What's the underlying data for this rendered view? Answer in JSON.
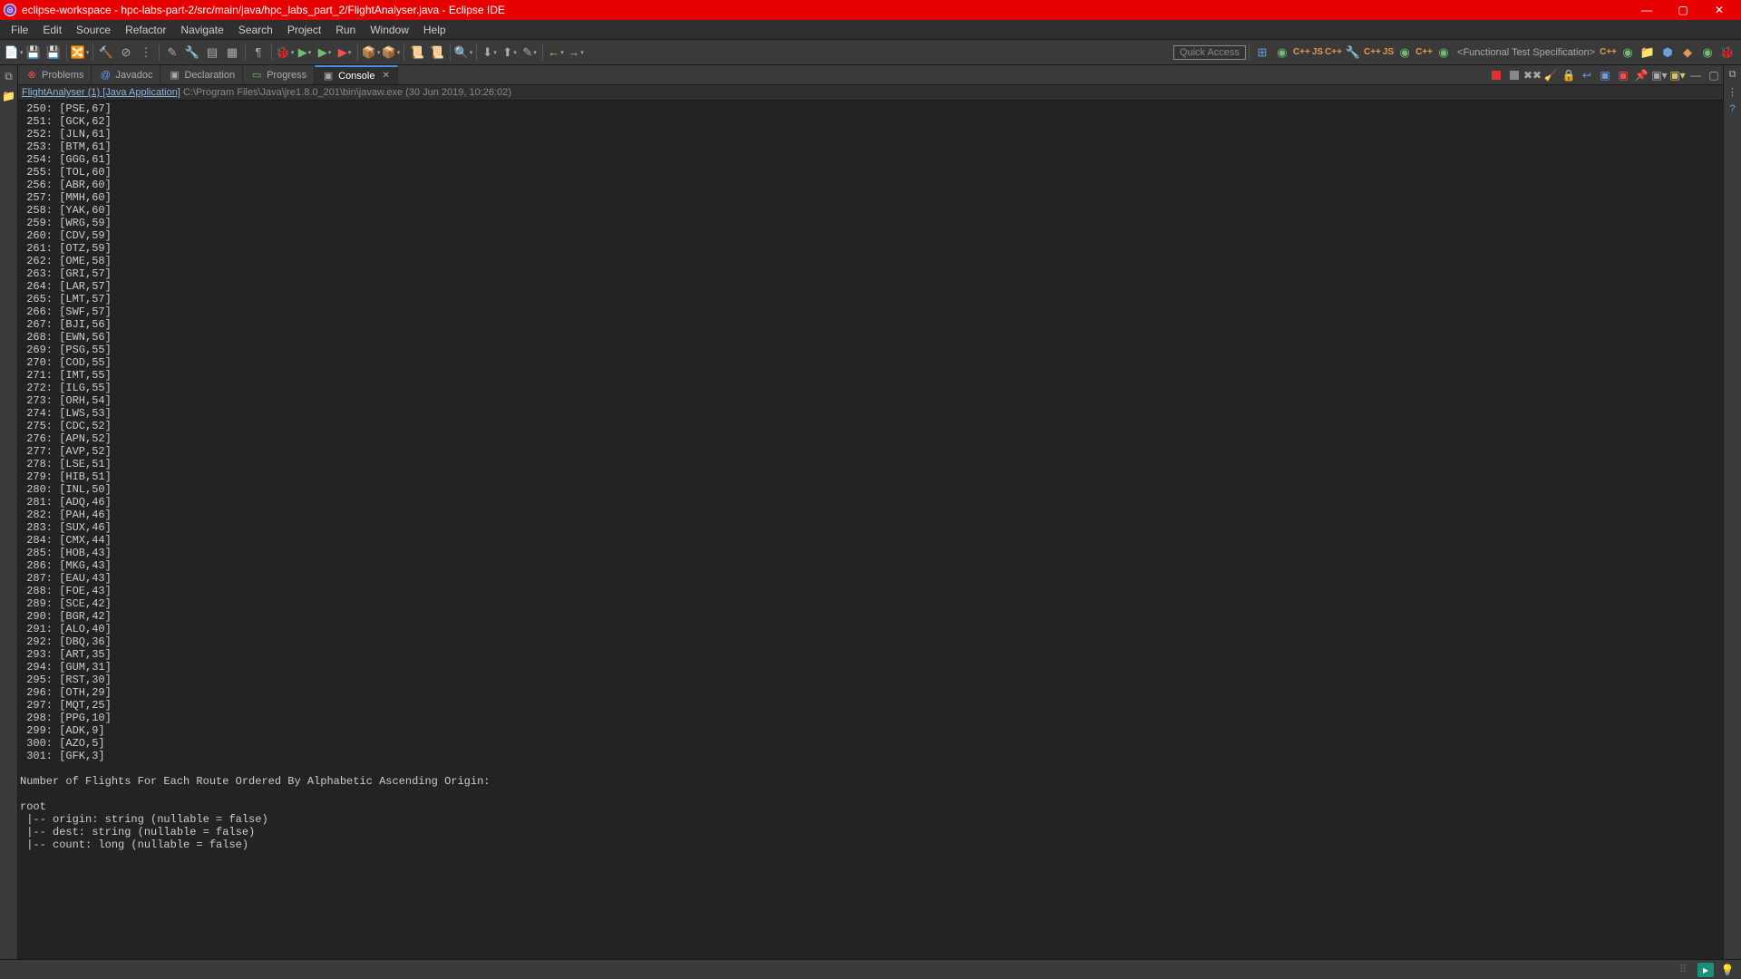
{
  "window": {
    "title": "eclipse-workspace - hpc-labs-part-2/src/main/java/hpc_labs_part_2/FlightAnalyser.java - Eclipse IDE"
  },
  "menu": [
    "File",
    "Edit",
    "Source",
    "Refactor",
    "Navigate",
    "Search",
    "Project",
    "Run",
    "Window",
    "Help"
  ],
  "quick_access": "Quick Access",
  "perspective_label": "<Functional Test Specification>",
  "tabs": {
    "problems": "Problems",
    "javadoc": "Javadoc",
    "declaration": "Declaration",
    "progress": "Progress",
    "console": "Console"
  },
  "launch": {
    "name": "FlightAnalyser (1) [Java Application]",
    "path": "C:\\Program Files\\Java\\jre1.8.0_201\\bin\\javaw.exe (30 Jun 2019, 10:26:02)"
  },
  "console_lines": [
    " 250: [PSE,67]",
    " 251: [GCK,62]",
    " 252: [JLN,61]",
    " 253: [BTM,61]",
    " 254: [GGG,61]",
    " 255: [TOL,60]",
    " 256: [ABR,60]",
    " 257: [MMH,60]",
    " 258: [YAK,60]",
    " 259: [WRG,59]",
    " 260: [CDV,59]",
    " 261: [OTZ,59]",
    " 262: [OME,58]",
    " 263: [GRI,57]",
    " 264: [LAR,57]",
    " 265: [LMT,57]",
    " 266: [SWF,57]",
    " 267: [BJI,56]",
    " 268: [EWN,56]",
    " 269: [PSG,55]",
    " 270: [COD,55]",
    " 271: [IMT,55]",
    " 272: [ILG,55]",
    " 273: [ORH,54]",
    " 274: [LWS,53]",
    " 275: [CDC,52]",
    " 276: [APN,52]",
    " 277: [AVP,52]",
    " 278: [LSE,51]",
    " 279: [HIB,51]",
    " 280: [INL,50]",
    " 281: [ADQ,46]",
    " 282: [PAH,46]",
    " 283: [SUX,46]",
    " 284: [CMX,44]",
    " 285: [HOB,43]",
    " 286: [MKG,43]",
    " 287: [EAU,43]",
    " 288: [FOE,43]",
    " 289: [SCE,42]",
    " 290: [BGR,42]",
    " 291: [ALO,40]",
    " 292: [DBQ,36]",
    " 293: [ART,35]",
    " 294: [GUM,31]",
    " 295: [RST,30]",
    " 296: [OTH,29]",
    " 297: [MQT,25]",
    " 298: [PPG,10]",
    " 299: [ADK,9]",
    " 300: [AZO,5]",
    " 301: [GFK,3]",
    "",
    "Number of Flights For Each Route Ordered By Alphabetic Ascending Origin:",
    "",
    "root",
    " |-- origin: string (nullable = false)",
    " |-- dest: string (nullable = false)",
    " |-- count: long (nullable = false)",
    ""
  ]
}
